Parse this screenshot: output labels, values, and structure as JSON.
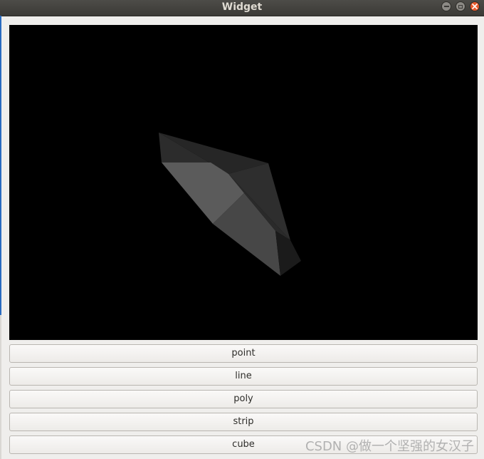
{
  "window": {
    "title": "Widget"
  },
  "buttons": {
    "point": "point",
    "line": "line",
    "poly": "poly",
    "strip": "strip",
    "cube": "cube"
  },
  "watermark": "CSDN @做一个坚强的女汉子",
  "colors": {
    "titlebar": "#3d3c38",
    "close_button": "#e95a2d",
    "gl_background": "#000000"
  },
  "icons": {
    "minimize": "minimize-icon",
    "maximize": "maximize-icon",
    "close": "close-icon"
  }
}
